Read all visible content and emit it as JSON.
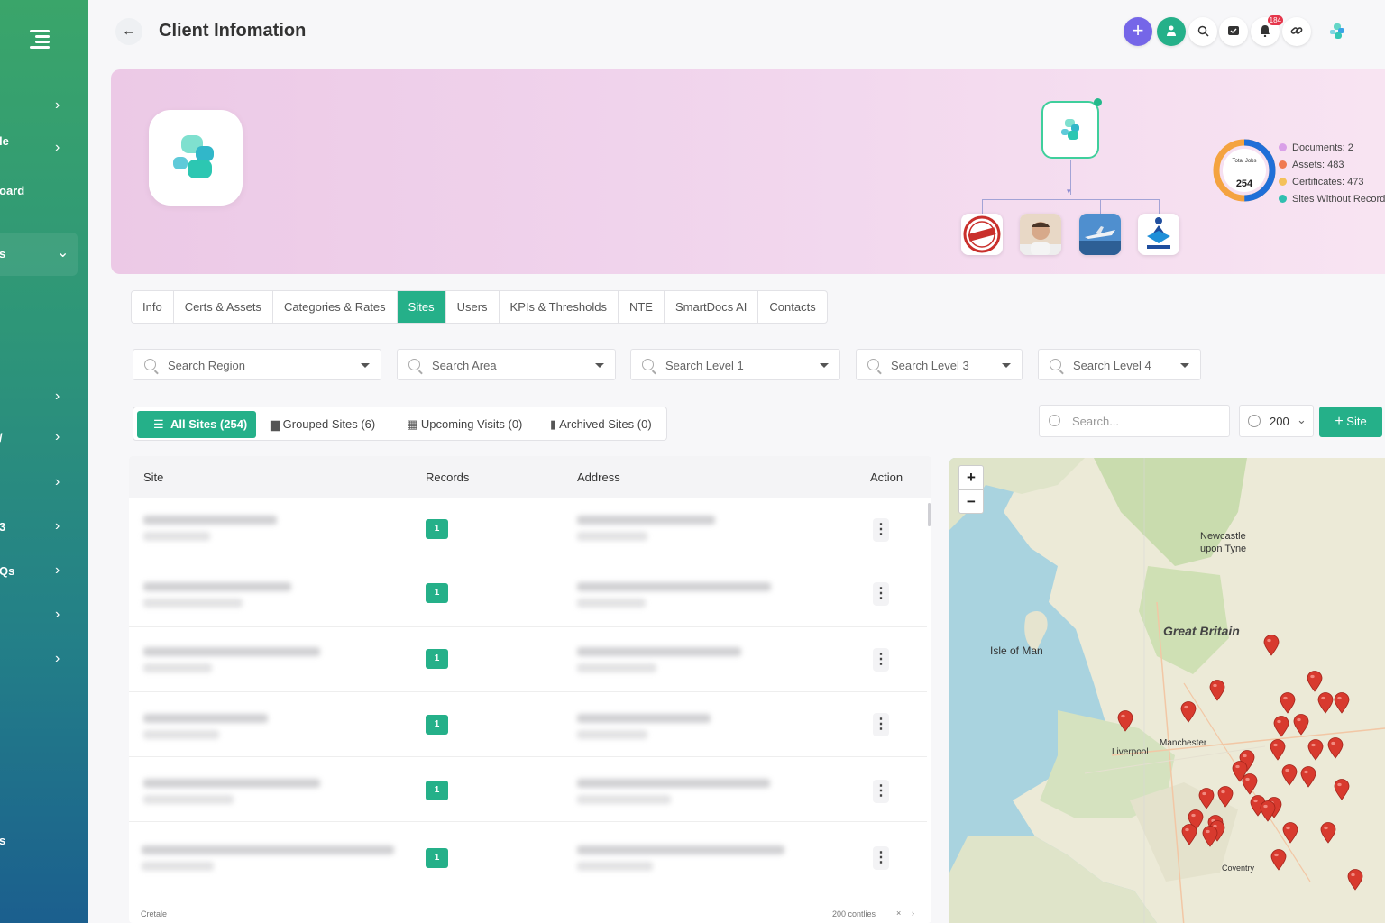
{
  "header": {
    "title": "Client Infomation",
    "notification_count": "184"
  },
  "sidebar": {
    "items": [
      {
        "label": "",
        "chevron": "›"
      },
      {
        "label": "le",
        "chevron": "›"
      },
      {
        "label": "oard",
        "chevron": ""
      },
      {
        "label": "s",
        "chevron": "⌄"
      },
      {
        "label": "",
        "chevron": "›"
      },
      {
        "label": "/",
        "chevron": "›"
      },
      {
        "label": "",
        "chevron": "›"
      },
      {
        "label": "3",
        "chevron": "›"
      },
      {
        "label": "Qs",
        "chevron": "›"
      },
      {
        "label": "",
        "chevron": "›"
      },
      {
        "label": "",
        "chevron": "›"
      },
      {
        "label": "s",
        "chevron": ""
      }
    ]
  },
  "banner": {
    "donut_label": "Total Jobs",
    "donut_value": "254",
    "legend": [
      {
        "label": "Documents: 2",
        "color": "#d9a0e8"
      },
      {
        "label": "Assets: 483",
        "color": "#f07a52"
      },
      {
        "label": "Certificates: 473",
        "color": "#f4c15a"
      },
      {
        "label": "Sites Without Records",
        "color": "#2fbfb0"
      }
    ],
    "donut_colors": [
      "#1f6fd8",
      "#f4a340",
      "#f4c15a"
    ]
  },
  "tabs": [
    "Info",
    "Certs & Assets",
    "Categories & Rates",
    "Sites",
    "Users",
    "KPIs & Thresholds",
    "NTE",
    "SmartDocs AI",
    "Contacts"
  ],
  "active_tab": "Sites",
  "filters": [
    "Search Region",
    "Search Area",
    "Search Level 1",
    "Search Level 3",
    "Search Level 4"
  ],
  "site_tabs": [
    "All Sites (254)",
    "Grouped Sites (6)",
    "Upcoming Visits (0)",
    "Archived Sites (0)"
  ],
  "table_search_placeholder": "Search...",
  "per_page": "200",
  "add_site_label": "Site",
  "table": {
    "columns": [
      "Site",
      "Records",
      "Address",
      "Action"
    ],
    "rows": [
      {
        "records": "1"
      },
      {
        "records": "1"
      },
      {
        "records": "1"
      },
      {
        "records": "1"
      },
      {
        "records": "1"
      },
      {
        "records": "1"
      }
    ],
    "footer_left": "Cretale",
    "footer_right": "200 contlies"
  },
  "map": {
    "labels": [
      "Newcastle upon Tyne",
      "Great Britain",
      "Isle of Man",
      "Liverpool",
      "Manchester",
      "Coventry"
    ],
    "zoom_in": "+",
    "zoom_out": "−"
  },
  "colors": {
    "accent": "#25b089",
    "purple": "#7566e8",
    "pin": "#d83a2e"
  }
}
